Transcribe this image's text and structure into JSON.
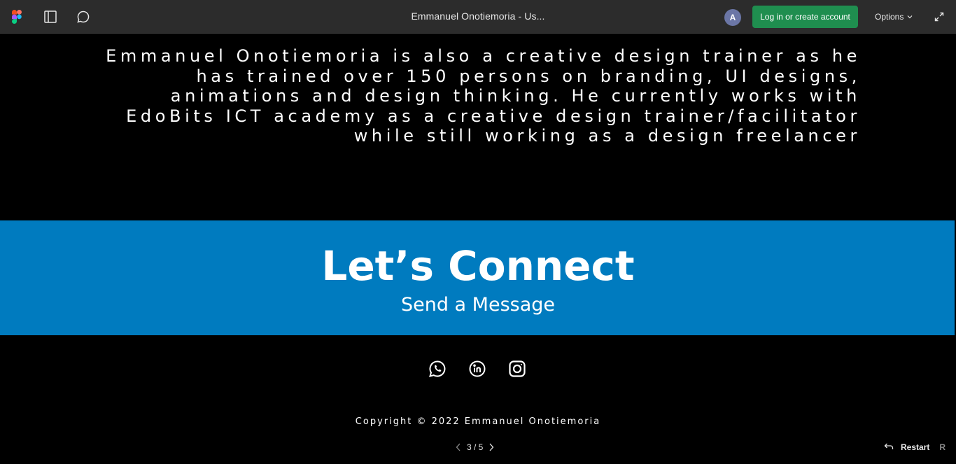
{
  "toolbar": {
    "title": "Emmanuel Onotiemoria - Us...",
    "avatar_initial": "A",
    "login_label": "Log in or create account",
    "options_label": "Options",
    "icons": [
      "figma-logo-icon",
      "sidebar-panel-icon",
      "comment-icon",
      "chevron-down-icon",
      "fullscreen-icon"
    ]
  },
  "frame": {
    "bio_text": "Emmanuel Onotiemoria is also a creative design trainer as he has trained over 150 persons on branding, UI designs, animations and design thinking. He currently works with EdoBits ICT academy as a creative design trainer/facilitator while still working as a design freelancer",
    "connect_title": "Let’s Connect",
    "connect_subtitle": "Send a Message",
    "social_icons": [
      "whatsapp-icon",
      "linkedin-icon",
      "instagram-icon"
    ],
    "copyright": "Copyright © 2022 Emmanuel Onotiemoria",
    "colors": {
      "background": "#000000",
      "connect_band": "#007bbf",
      "text": "#ffffff"
    }
  },
  "footer": {
    "page_indicator": "3 / 5",
    "restart_label": "Restart",
    "restart_key": "R"
  },
  "colors": {
    "toolbar_bg": "#2c2c2c",
    "login_button": "#1f8e4f",
    "avatar": "#6b76a6"
  }
}
